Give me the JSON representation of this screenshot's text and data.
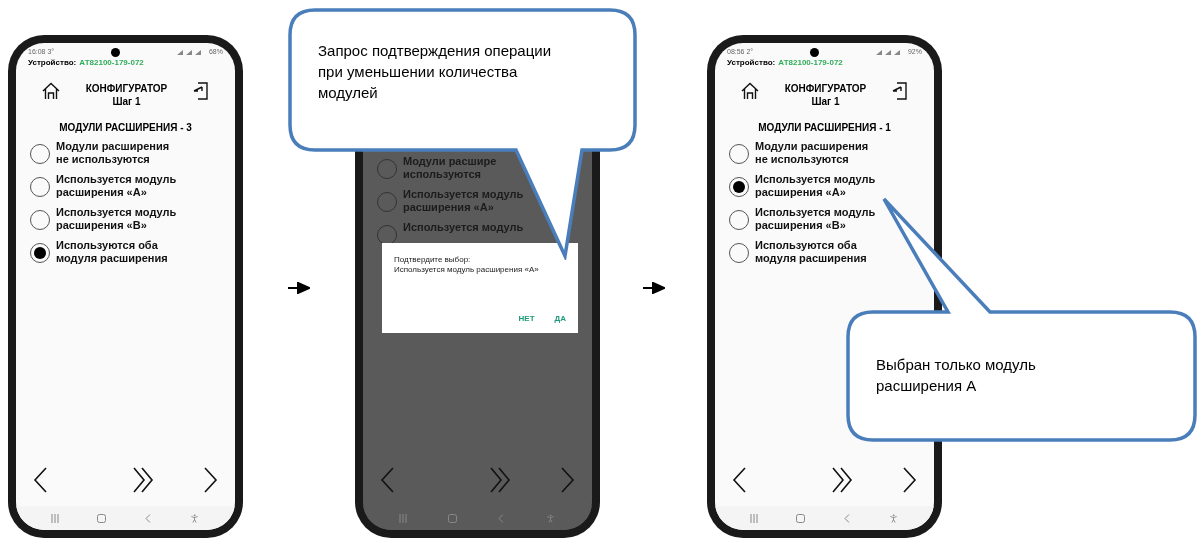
{
  "screens": [
    {
      "dimmed": false,
      "status": {
        "time": "16:08",
        "temperature": "3°",
        "battery": "68%"
      },
      "device_label": "Устройство:",
      "device_id": "АТ82100-179-072",
      "title": "КОНФИГУРАТОР",
      "step": "Шаг 1",
      "section": "МОДУЛИ РАСШИРЕНИЯ - 3",
      "options": [
        {
          "label": "Модули расширения не используются",
          "selected": false
        },
        {
          "label": "Используется модуль расширения «А»",
          "selected": false
        },
        {
          "label": "Используется модуль расширения «В»",
          "selected": false
        },
        {
          "label": "Используются оба модуля расширения",
          "selected": true
        }
      ]
    },
    {
      "dimmed": true,
      "options": [
        {
          "label": "Модули расшире используются",
          "selected": false
        },
        {
          "label": "Используется модуль расширения «А»",
          "selected": false
        },
        {
          "label": "Используется модуль",
          "selected": false
        }
      ],
      "dialog": {
        "title": "Подтвердите выбор:",
        "message": "Используется модуль расширения «А»",
        "buttons": [
          "НЕТ",
          "ДА"
        ]
      }
    },
    {
      "dimmed": false,
      "status": {
        "time": "08:56",
        "temperature": "2°",
        "battery": "92%"
      },
      "device_label": "Устройство:",
      "device_id": "АТ82100-179-072",
      "title": "КОНФИГУРАТОР",
      "step": "Шаг 1",
      "section": "МОДУЛИ РАСШИРЕНИЯ - 1",
      "options": [
        {
          "label": "Модули расширения не используются",
          "selected": false
        },
        {
          "label": "Используется модуль расширения «А»",
          "selected": true
        },
        {
          "label": "Используется модуль расширения «В»",
          "selected": false
        },
        {
          "label": "Используются оба модуля расширения",
          "selected": false
        }
      ]
    }
  ],
  "callouts": [
    {
      "text": "Запрос подтверждения операции при уменьшении количества модулей"
    },
    {
      "text": "Выбран только модуль расширения А"
    }
  ]
}
